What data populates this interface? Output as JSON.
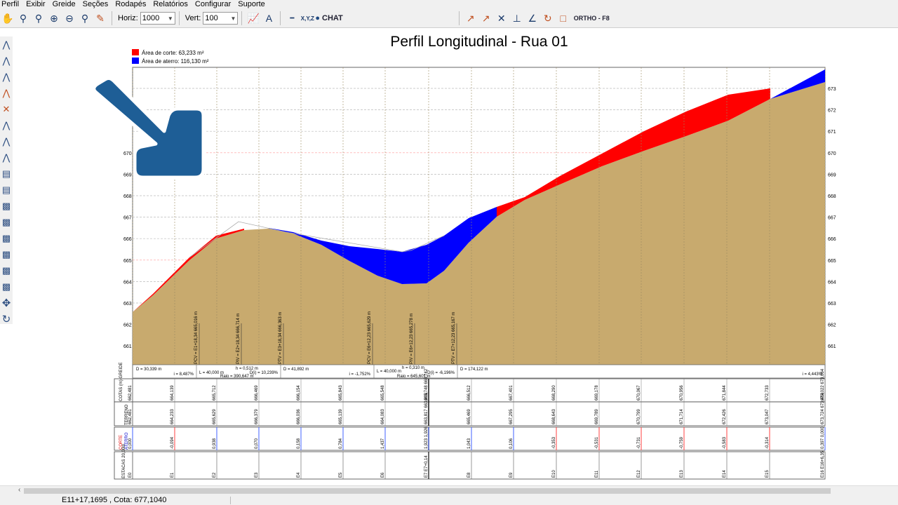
{
  "menu": [
    "Perfil",
    "Exibir",
    "Greide",
    "Seções",
    "Rodapés",
    "Relatórios",
    "Configurar",
    "Suporte"
  ],
  "toolbar": {
    "horiz_label": "Horiz:",
    "horiz_value": "1000",
    "vert_label": "Vert:",
    "vert_value": "100",
    "xyz_label": "X,Y,Z",
    "chat_label": "CHAT",
    "ortho_label": "ORTHO - F8"
  },
  "profile": {
    "title": "Perfil Longitudinal - Rua 01",
    "legend_cut": "Área de corte: 63,233 m²",
    "legend_fill": "Área de aterro: 116,130 m²",
    "color_cut": "#ff0000",
    "color_fill": "#0000ff",
    "color_ground": "#c8aa6e",
    "elev_labels": [
      "673",
      "672",
      "671",
      "670",
      "669",
      "668",
      "667",
      "666",
      "665",
      "664",
      "663",
      "662",
      "661"
    ],
    "grade_notes": [
      {
        "d": "D = 30,339 m",
        "i": "i = 8,487%"
      },
      {
        "d": "L = 40,000 m",
        "h": "h = 0,512 m",
        "di": "D(i) = 10,239%",
        "raio": "Raio = 390,647 m"
      },
      {
        "d": "D = 41,892 m",
        "i": "i = -1,752%"
      },
      {
        "d": "L = 40,000 m",
        "h": "h = 0,310 m",
        "di": "D(i) = -6,196%",
        "raio": "Raio = 645,601 m"
      },
      {
        "d": "D = 174,122 m",
        "i": "i = 4,443%"
      }
    ],
    "curve_labels": [
      "PCV = E1+18,34 665,016 m",
      "PIV = E2+18,34 666,714 m",
      "PTV = E3+18,34 666,363 m",
      "PCV = E6+12,23 665,629 m",
      "PIV = E6+12,23 665,278 m",
      "PTV = E7+12,23 665,167 m"
    ]
  },
  "table": {
    "row_headers": [
      "COTAS (m) GREIDE",
      "TERRENO",
      "CORTE",
      "ATERRO",
      "ESTACAS 20,00m"
    ],
    "stations": [
      "E0",
      "E1",
      "E2",
      "E3",
      "E4",
      "E5",
      "E6",
      "E7 E7+0,14",
      "E8",
      "E9",
      "E10",
      "E11",
      "E12",
      "E13",
      "E14",
      "E15",
      "E16 E16+6,35"
    ],
    "greide": [
      "662,481",
      "664,139",
      "665,712",
      "666,469",
      "666,154",
      "665,843",
      "665,548",
      "665,748 665,742",
      "666,512",
      "667,401",
      "668,290",
      "669,178",
      "670,067",
      "670,956",
      "671,844",
      "672,733",
      "673,022 673,064"
    ],
    "terreno": [
      "662,481",
      "664,233",
      "665,629",
      "666,379",
      "666,036",
      "665,139",
      "664,083",
      "663,817 663,818",
      "665,469",
      "667,295",
      "668,643",
      "669,789",
      "670,799",
      "671,714",
      "672,426",
      "673,047",
      "673,724 673,464"
    ],
    "corte_aterro": [
      "0,000",
      "-0,094",
      "0,938",
      "0,070",
      "0,158",
      "0,784",
      "1,437",
      "1,923 1,926",
      "1,043",
      "0,106",
      "-0,353",
      "-0,531",
      "-0,731",
      "-0,759",
      "-0,583",
      "-0,314",
      "0,397 0,000"
    ]
  },
  "status": {
    "coords": "E11+17,1695 , Cota: 677,1040"
  }
}
